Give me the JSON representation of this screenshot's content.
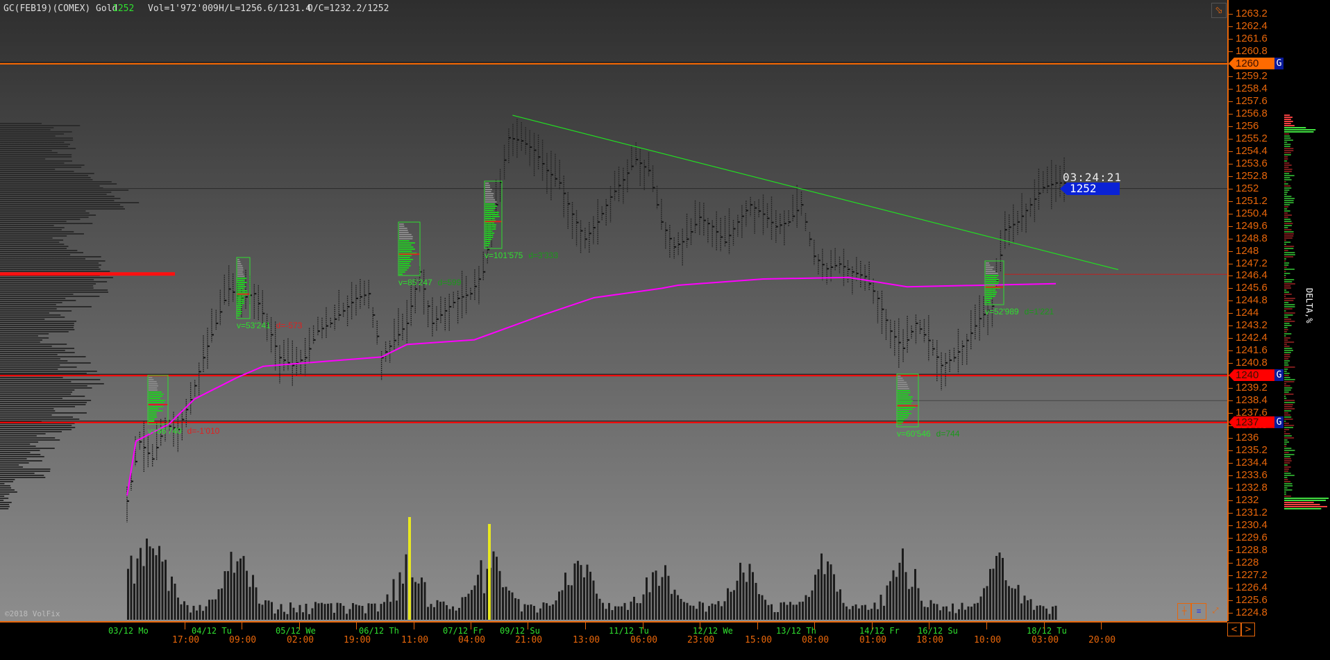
{
  "header": {
    "symbol": "GC(FEB19)(COMEX) Gold",
    "last": "1252",
    "volume": "Vol=1'972'009",
    "high_low": "H/L=1256.6/1231.4",
    "open_close": "O/C=1232.2/1252"
  },
  "colors": {
    "axis": "#e8660a",
    "up": "#2fe02f",
    "down": "#e02020",
    "vwap": "#ff00ff",
    "current": "#0a22d6"
  },
  "price_axis": {
    "max": 1263.2,
    "min": 1224.8,
    "step": 0.8
  },
  "tags": [
    {
      "price": 1260,
      "label": "1260",
      "g": "G",
      "color": "#ff6a00"
    },
    {
      "price": 1240,
      "label": "1240",
      "g": "G",
      "color": "#ff0000"
    },
    {
      "price": 1237,
      "label": "1237",
      "g": "G",
      "color": "#ff0000"
    }
  ],
  "current": {
    "price": 1252,
    "label": "1252",
    "timer": "03:24:21"
  },
  "time_axis": {
    "dates": [
      "03/12 Mo",
      "04/12 Tu",
      "05/12 We",
      "06/12 Th",
      "07/12 Fr",
      "09/12 Su",
      "11/12 Tu",
      "12/12 We",
      "13/12 Th",
      "14/12 Fr",
      "16/12 Su",
      "18/12 Tu"
    ],
    "times": [
      "17:00",
      "09:00",
      "02:00",
      "19:00",
      "11:00",
      "04:00",
      "21:00",
      "13:00",
      "06:00",
      "23:00",
      "15:00",
      "08:00",
      "01:00",
      "18:00",
      "10:00",
      "03:00",
      "20:00"
    ]
  },
  "profiles": [
    {
      "v": "v=86'740",
      "d": "d=-1'010",
      "neg": true
    },
    {
      "v": "v=53'241",
      "d": "d=-573",
      "neg": true
    },
    {
      "v": "v=85'247",
      "d": "d=599",
      "neg": false
    },
    {
      "v": "v=101'575",
      "d": "d=3'333",
      "neg": false
    },
    {
      "v": "v=60'546",
      "d": "d=744",
      "neg": false
    },
    {
      "v": "v=52'989",
      "d": "d=1'221",
      "neg": false
    }
  ],
  "copyright": "©2018 VolFix",
  "delta_title": "DELTA,%",
  "icons": {
    "tag": "tag-icon",
    "prev": "chevron-left-icon",
    "next": "chevron-right-icon"
  },
  "chart_data": {
    "type": "line",
    "title": "GC(FEB19)(COMEX) Gold",
    "price_path": [
      1232.0,
      1235.8,
      1234.7,
      1236.9,
      1236.6,
      1238.5,
      1241.2,
      1243.4,
      1245.6,
      1245.0,
      1245.3,
      1243.4,
      1241.2,
      1240.7,
      1241.2,
      1242.9,
      1243.4,
      1244.2,
      1245.0,
      1245.3,
      1241.2,
      1242.3,
      1243.4,
      1246.7,
      1243.4,
      1244.2,
      1245.0,
      1245.3,
      1246.7,
      1251.0,
      1255.3,
      1255.1,
      1254.5,
      1253.2,
      1252.4,
      1250.4,
      1248.8,
      1249.9,
      1251.5,
      1252.6,
      1253.9,
      1253.2,
      1249.9,
      1248.3,
      1248.8,
      1250.2,
      1249.6,
      1248.6,
      1249.9,
      1251.0,
      1250.4,
      1249.6,
      1249.9,
      1251.0,
      1247.7,
      1246.9,
      1247.2,
      1246.7,
      1246.4,
      1245.0,
      1242.9,
      1241.8,
      1243.4,
      1242.3,
      1240.7,
      1241.2,
      1242.3,
      1243.7,
      1244.5,
      1249.4,
      1249.9,
      1251.0,
      1252.1,
      1252.4
    ],
    "vwap": [
      [
        0,
        1232.3
      ],
      [
        0.7,
        1235.8
      ],
      [
        3.3,
        1236.9
      ],
      [
        5.3,
        1238.5
      ],
      [
        8.7,
        1239.9
      ],
      [
        10.7,
        1240.6
      ],
      [
        20,
        1241.2
      ],
      [
        22,
        1242.0
      ],
      [
        27.3,
        1242.3
      ],
      [
        32.7,
        1243.9
      ],
      [
        36.7,
        1245.0
      ],
      [
        42,
        1245.6
      ],
      [
        43.3,
        1245.8
      ],
      [
        50,
        1246.2
      ],
      [
        56.7,
        1246.3
      ],
      [
        61.3,
        1245.7
      ],
      [
        73,
        1245.9
      ]
    ],
    "trendline": [
      [
        30.3,
        1256.7
      ],
      [
        77.9,
        1246.8
      ]
    ],
    "levels": {
      "poc": 1246.5,
      "resistance": 1260,
      "support": [
        1240,
        1237
      ]
    }
  }
}
